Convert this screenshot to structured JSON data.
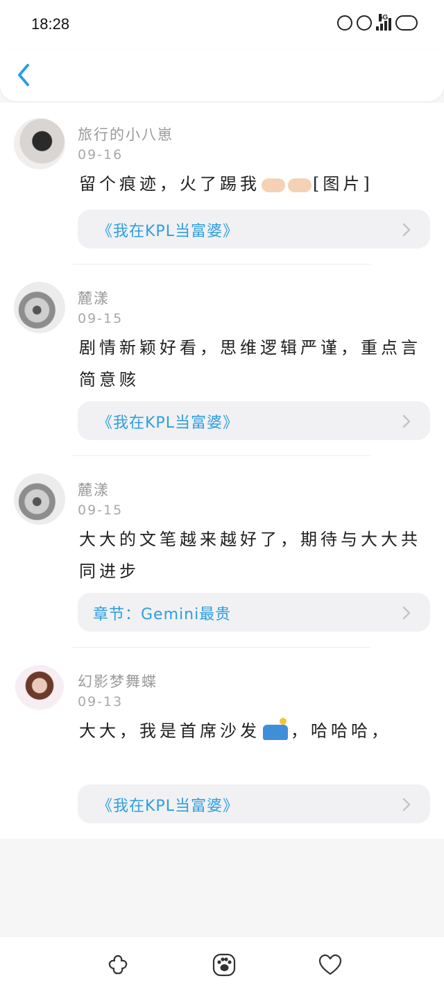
{
  "status_bar": {
    "time": "18:28",
    "network": "5G"
  },
  "header": {
    "back_icon": "chevron-left-icon"
  },
  "comments": [
    {
      "name": "旅行的小八崽",
      "date": "09-16",
      "text": "留个痕迹，火了踢我",
      "text_suffix": "[图片]",
      "link": "《我在KPL当富婆》"
    },
    {
      "name": "麓漾",
      "date": "09-15",
      "text": "剧情新颖好看，思维逻辑严谨，重点言简意赅",
      "link": "《我在KPL当富婆》"
    },
    {
      "name": "麓漾",
      "date": "09-15",
      "text": "大大的文笔越来越好了，期待与大大共同进步",
      "link": "章节：Gemini最贵"
    },
    {
      "name": "幻影梦舞蝶",
      "date": "09-13",
      "text_prefix": "大大，我是首席沙发",
      "text": "，哈哈哈，",
      "link": "《我在KPL当富婆》"
    }
  ],
  "bottom_bar": {
    "icons": [
      "flower-icon",
      "paw-icon",
      "heart-icon"
    ]
  },
  "colors": {
    "accent": "#2d9ee0",
    "muted_text": "#9a9a9a"
  }
}
